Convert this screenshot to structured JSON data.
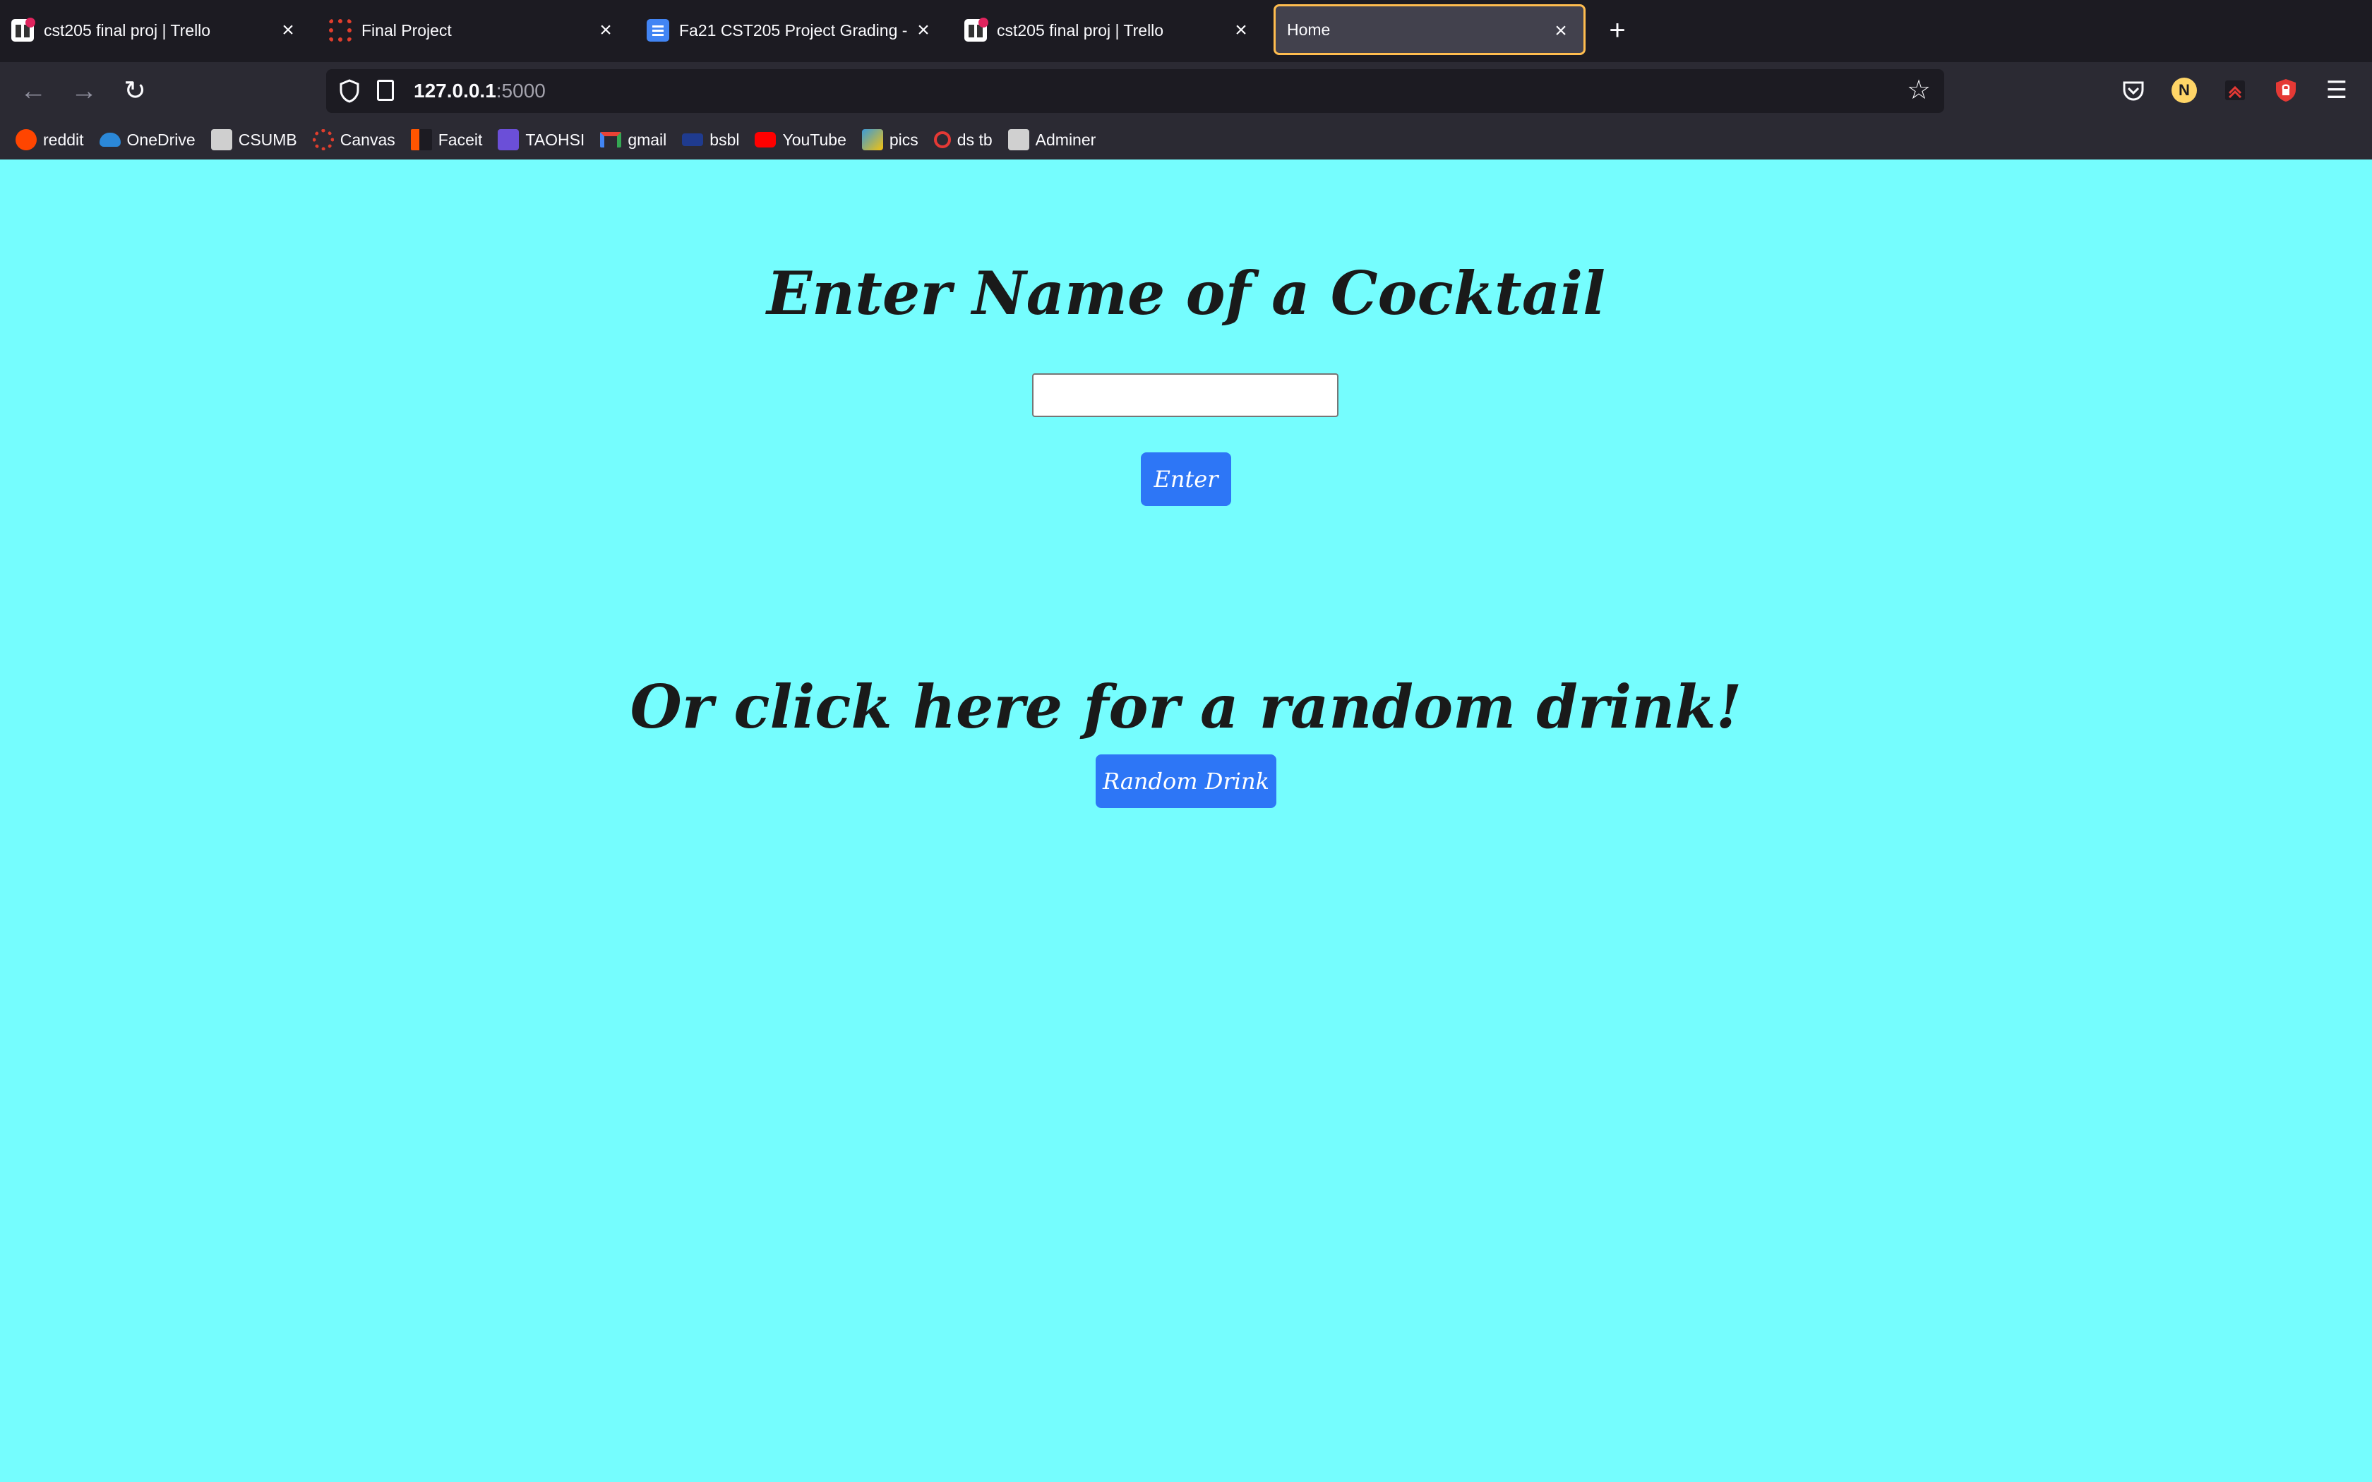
{
  "browser": {
    "tabs": [
      {
        "title": "cst205 final proj | Trello",
        "icon": "trello-icon",
        "active": false
      },
      {
        "title": "Final Project",
        "icon": "canvas-icon",
        "active": false
      },
      {
        "title": "Fa21 CST205 Project Grading -",
        "icon": "docs-icon",
        "active": false
      },
      {
        "title": "cst205 final proj | Trello",
        "icon": "trello-icon",
        "active": false
      },
      {
        "title": "Home",
        "icon": "",
        "active": true
      }
    ],
    "url": {
      "host": "127.0.0.1",
      "port": ":5000"
    },
    "profile_initial": "N",
    "bookmarks": [
      {
        "label": "reddit",
        "icon": "reddit-icon",
        "color": "#ff4500"
      },
      {
        "label": "OneDrive",
        "icon": "onedrive-icon",
        "color": "#2b88d8"
      },
      {
        "label": "CSUMB",
        "icon": "csumb-icon",
        "color": "#cfcfcf"
      },
      {
        "label": "Canvas",
        "icon": "canvas-icon",
        "color": "#e03e2d"
      },
      {
        "label": "Faceit",
        "icon": "faceit-icon",
        "color": "#ff5500"
      },
      {
        "label": "TAOHSI",
        "icon": "list-icon",
        "color": "#6b4fd8"
      },
      {
        "label": "gmail",
        "icon": "gmail-icon",
        "color": "#ea4335"
      },
      {
        "label": "bsbl",
        "icon": "mlb-icon",
        "color": "#1f3b8f"
      },
      {
        "label": "YouTube",
        "icon": "youtube-icon",
        "color": "#ff0000"
      },
      {
        "label": "pics",
        "icon": "pics-icon",
        "color": "#3a9ad9"
      },
      {
        "label": "ds tb",
        "icon": "ds-icon",
        "color": "#e53935"
      },
      {
        "label": "Adminer",
        "icon": "adminer-icon",
        "color": "#d0d0d0"
      }
    ]
  },
  "page": {
    "heading": "Enter Name of a Cocktail",
    "input_value": "",
    "enter_label": "Enter",
    "random_heading": "Or click here for a random drink!",
    "random_label": "Random Drink",
    "background_color": "#75fdfe",
    "button_color": "#2d76f6"
  }
}
